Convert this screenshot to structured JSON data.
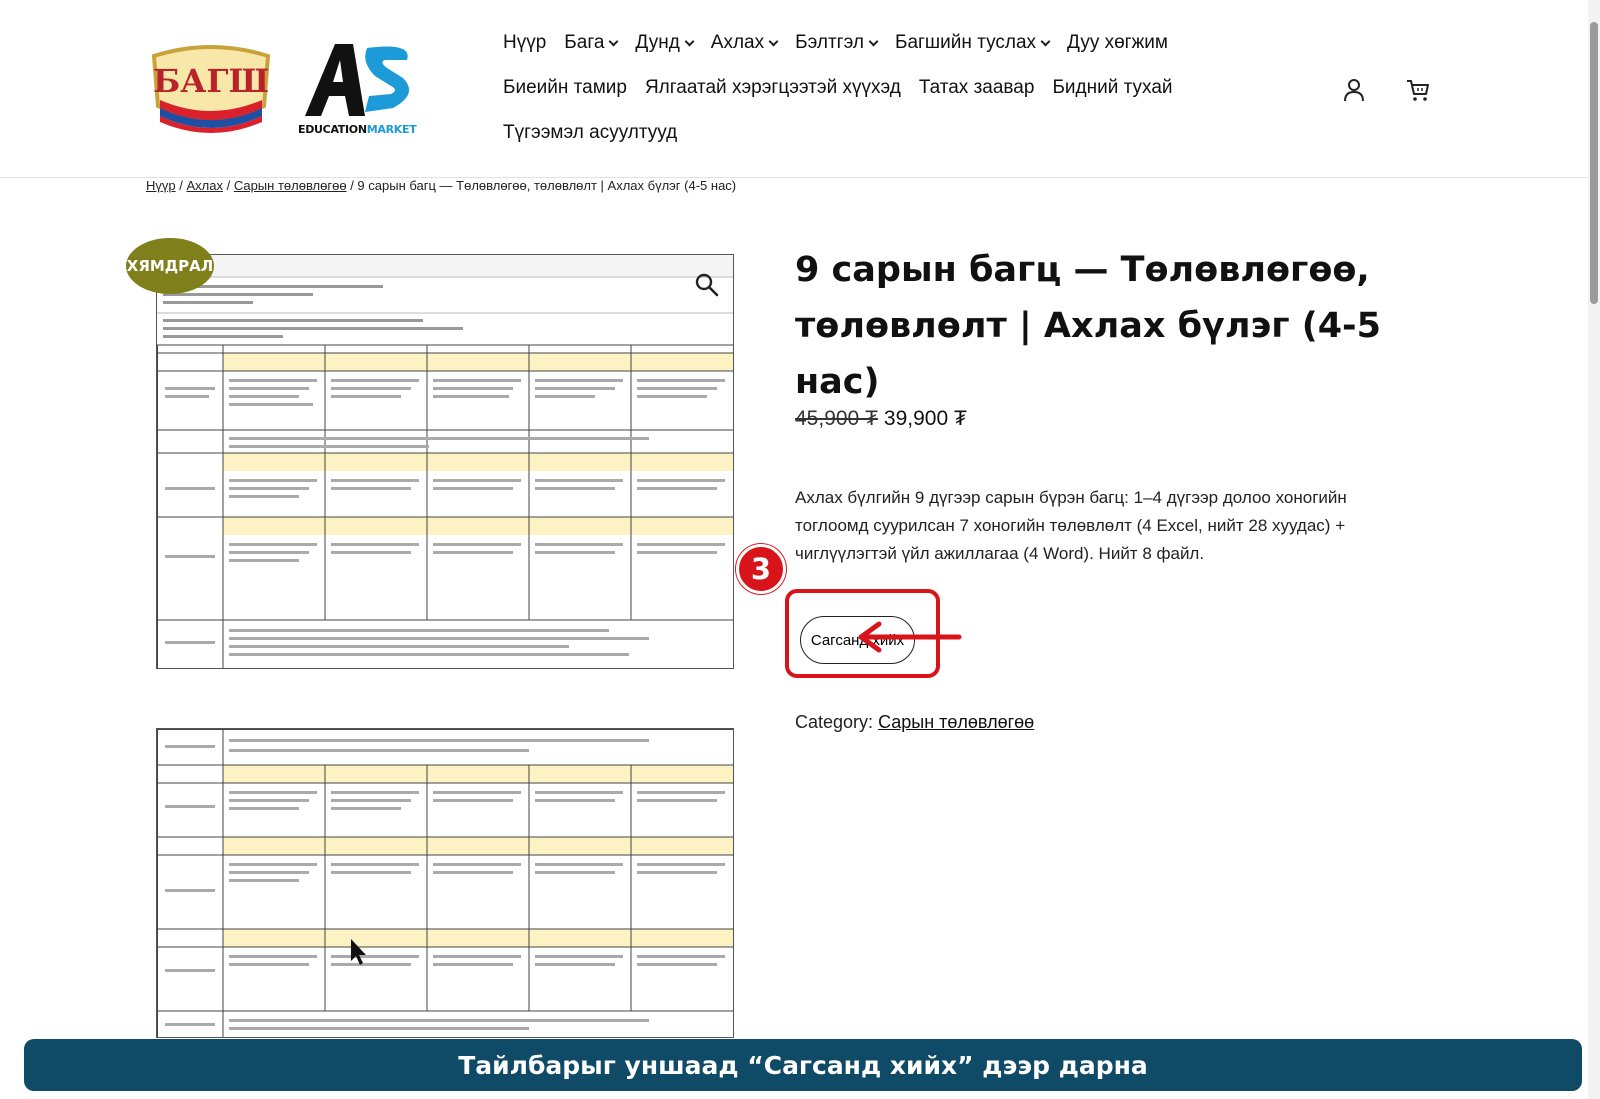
{
  "nav": {
    "row1": [
      {
        "label": "Нүүр",
        "dropdown": false
      },
      {
        "label": "Бага",
        "dropdown": true
      },
      {
        "label": "Дунд",
        "dropdown": true
      },
      {
        "label": "Ахлах",
        "dropdown": true
      },
      {
        "label": "Бэлтгэл",
        "dropdown": true
      },
      {
        "label": "Багшийн туслах",
        "dropdown": true
      },
      {
        "label": "Дуу хөгжим",
        "dropdown": false
      }
    ],
    "row2": [
      {
        "label": "Биеийн тамир"
      },
      {
        "label": "Ялгаатай хэрэгцээтэй хүүхэд"
      },
      {
        "label": "Татах заавар"
      },
      {
        "label": "Бидний тухай"
      }
    ],
    "row3": [
      {
        "label": "Түгээмэл асуултууд"
      }
    ],
    "icons": [
      "account-icon",
      "cart-icon"
    ]
  },
  "logos": {
    "bagsh": "БАГШ",
    "edu_part1": "EDUCATION",
    "edu_part2": "MARKET"
  },
  "breadcrumb": {
    "items": [
      "Нүүр",
      "Ахлах",
      "Сарын төлөвлөгөө"
    ],
    "sep": " / ",
    "current": "9 сарын багц — Төлөвлөгөө, төлөвлөлт | Ахлах бүлэг (4-5 нас)"
  },
  "gallery": {
    "sale_badge": "ХЯМДРАЛ"
  },
  "product": {
    "title": "9 сарын багц — Төлөвлөгөө, төлөвлөлт | Ахлах бүлэг (4-5 нас)",
    "old_price": "45,900 ₮",
    "price": "39,900 ₮",
    "description": "Ахлах бүлгийн 9 дүгээр сарын бүрэн багц: 1–4 дүгээр долоо хоногийн тоглоомд суурилсан 7 хоногийн төлөвлөлт (4 Excel, нийт 28 хуудас) + чиглүүлэгтэй үйл ажиллагаа (4 Word). Нийт 8 файл.",
    "add_to_cart": "Сагсанд хийх",
    "category_label": "Category:",
    "category": "Сарын төлөвлөгөө"
  },
  "annotation": {
    "step": "3",
    "caption": "Тайлбарыг уншаад “Сагсанд хийх” дээр дарна"
  },
  "colors": {
    "accent_red": "#d8141a",
    "caption_bg": "#0f4a66",
    "sale_badge": "#7f7f1c",
    "sheet_header": "#fdf2c4"
  }
}
